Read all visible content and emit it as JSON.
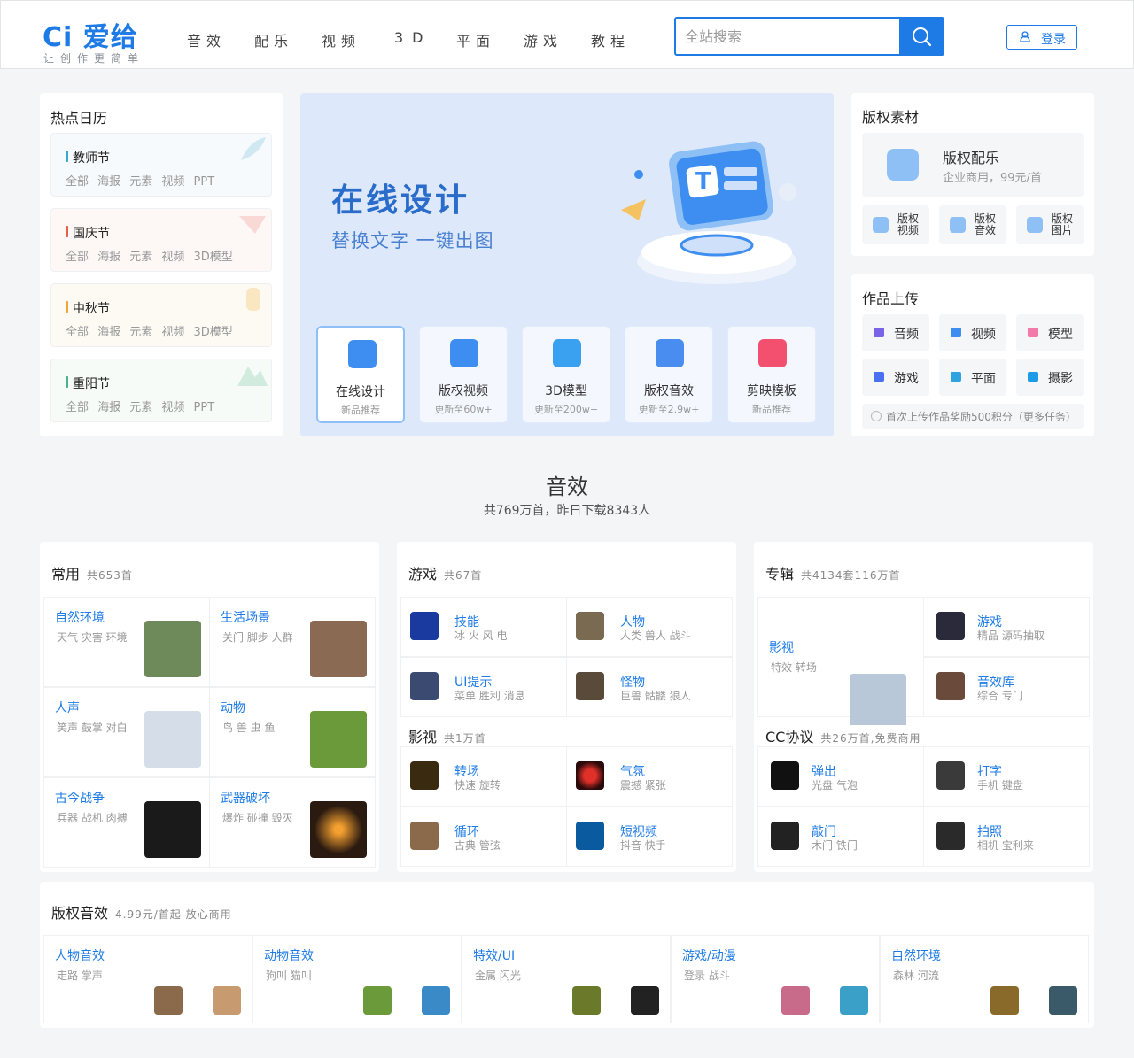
{
  "header": {
    "logo": "Ci 爱给",
    "slogan": "让创作更简单",
    "nav": [
      "音效",
      "配乐",
      "视频",
      "3D",
      "平面",
      "游戏",
      "教程"
    ],
    "search_placeholder": "全站搜索",
    "login": "登录"
  },
  "calendar": {
    "title": "热点日历",
    "items": [
      {
        "name": "教师节",
        "tags": "全部 海报 元素 视频 PPT",
        "color": "#3aa8c9"
      },
      {
        "name": "国庆节",
        "tags": "全部 海报 元素 视频 3D模型",
        "color": "#e8604a"
      },
      {
        "name": "中秋节",
        "tags": "全部 海报 元素 视频 3D模型",
        "color": "#f0a43c"
      },
      {
        "name": "重阳节",
        "tags": "全部 海报 元素 视频 PPT",
        "color": "#4ab38a"
      }
    ]
  },
  "banner": {
    "title": "在线设计",
    "subtitle": "替换文字 一键出图",
    "tiles": [
      {
        "label": "在线设计",
        "sub": "新品推荐",
        "icon": "design-icon",
        "color": "#3d8ef0"
      },
      {
        "label": "版权视频",
        "sub": "更新至60w+",
        "icon": "video-icon",
        "color": "#3d8ef0"
      },
      {
        "label": "3D模型",
        "sub": "更新至200w+",
        "icon": "cube-icon",
        "color": "#3aa0f0"
      },
      {
        "label": "版权音效",
        "sub": "更新至2.9w+",
        "icon": "shield-sound-icon",
        "color": "#4a8df0"
      },
      {
        "label": "剪映模板",
        "sub": "新品推荐",
        "icon": "capcut-icon",
        "color": "#f2506e"
      }
    ]
  },
  "copyright": {
    "title": "版权素材",
    "main": {
      "title": "版权配乐",
      "sub": "企业商用，99元/首"
    },
    "small": [
      {
        "label": "版权\n视频",
        "l1": "版权",
        "l2": "视频"
      },
      {
        "label": "版权\n音效",
        "l1": "版权",
        "l2": "音效"
      },
      {
        "label": "版权\n图片",
        "l1": "版权",
        "l2": "图片"
      }
    ]
  },
  "upload": {
    "title": "作品上传",
    "items": [
      {
        "label": "音频",
        "color": "#7b63e8"
      },
      {
        "label": "视频",
        "color": "#3d8ef0"
      },
      {
        "label": "模型",
        "color": "#f27aa8"
      },
      {
        "label": "游戏",
        "color": "#4a6ff0"
      },
      {
        "label": "平面",
        "color": "#2fa3e0"
      },
      {
        "label": "摄影",
        "color": "#1e9be6"
      }
    ],
    "note": "首次上传作品奖励500积分（更多任务）"
  },
  "section": {
    "title": "音效",
    "subtitle": "共769万首，昨日下载8343人"
  },
  "common": {
    "title": "常用",
    "count": "共653首",
    "items": [
      {
        "name": "自然环境",
        "desc": "天气 灾害 环境"
      },
      {
        "name": "生活场景",
        "desc": "关门 脚步 人群"
      },
      {
        "name": "人声",
        "desc": "笑声 鼓掌 对白"
      },
      {
        "name": "动物",
        "desc": "鸟 兽 虫 鱼"
      },
      {
        "name": "古今战争",
        "desc": "兵器 战机 肉搏"
      },
      {
        "name": "武器破坏",
        "desc": "爆炸 碰撞 毁灭"
      }
    ]
  },
  "game": {
    "title": "游戏",
    "count": "共67首",
    "items": [
      {
        "name": "技能",
        "desc": "冰 火 风 电"
      },
      {
        "name": "人物",
        "desc": "人类 兽人 战斗"
      },
      {
        "name": "UI提示",
        "desc": "菜单 胜利 消息"
      },
      {
        "name": "怪物",
        "desc": "巨兽 骷髅 狼人"
      }
    ]
  },
  "film": {
    "title": "影视",
    "count": "共1万首",
    "items": [
      {
        "name": "转场",
        "desc": "快速 旋转"
      },
      {
        "name": "气氛",
        "desc": "震撼 紧张"
      },
      {
        "name": "循环",
        "desc": "古典 管弦"
      },
      {
        "name": "短视频",
        "desc": "抖音 快手"
      }
    ]
  },
  "album": {
    "title": "专辑",
    "count": "共4134套116万首",
    "big": {
      "name": "影视",
      "desc": "特效 转场"
    },
    "items": [
      {
        "name": "游戏",
        "desc": "精品 源码抽取"
      },
      {
        "name": "音效库",
        "desc": "综合 专门"
      }
    ]
  },
  "cc": {
    "title": "CC协议",
    "count": "共26万首,免费商用",
    "items": [
      {
        "name": "弹出",
        "desc": "光盘 气泡"
      },
      {
        "name": "打字",
        "desc": "手机 键盘"
      },
      {
        "name": "敲门",
        "desc": "木门 铁门"
      },
      {
        "name": "拍照",
        "desc": "相机 宝利来"
      }
    ]
  },
  "bottom": {
    "title": "版权音效",
    "count": "4.99元/首起 放心商用",
    "items": [
      {
        "name": "人物音效",
        "desc": "走路 掌声"
      },
      {
        "name": "动物音效",
        "desc": "狗叫 猫叫"
      },
      {
        "name": "特效/UI",
        "desc": "金属 闪光"
      },
      {
        "name": "游戏/动漫",
        "desc": "登录 战斗"
      },
      {
        "name": "自然环境",
        "desc": "森林 河流"
      }
    ]
  }
}
